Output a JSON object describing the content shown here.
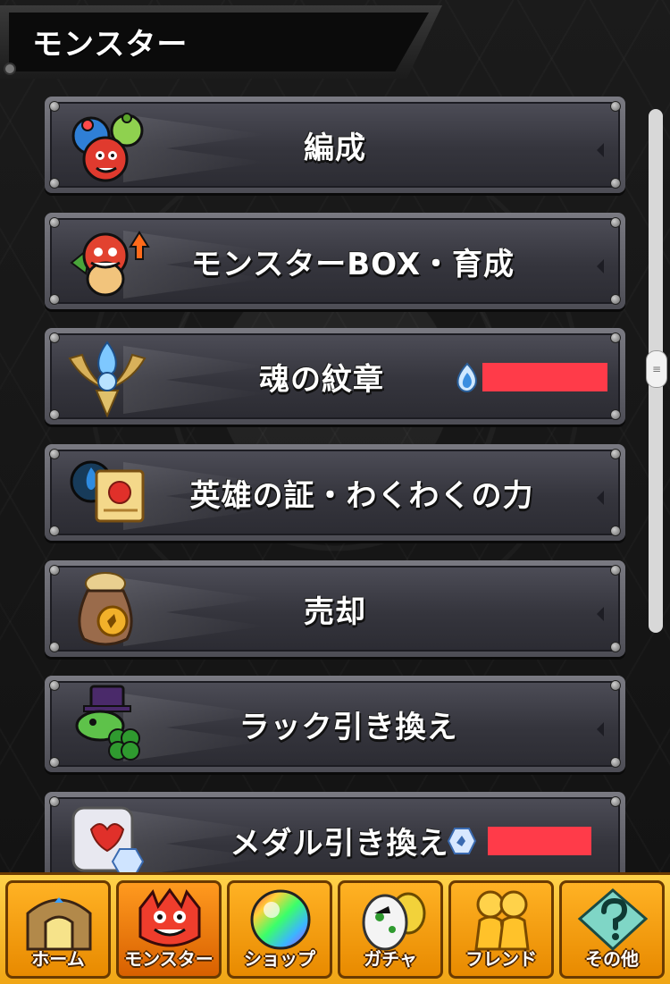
{
  "header": {
    "title": "モンスター"
  },
  "menu": {
    "items": [
      {
        "label": "編成",
        "icon": "monster-group-icon"
      },
      {
        "label": "モンスターBOX・育成",
        "icon": "dragon-powerup-icon"
      },
      {
        "label": "魂の紋章",
        "icon": "winged-soul-emblem-icon",
        "counter_icon": "blue-flame-icon"
      },
      {
        "label": "英雄の証・わくわくの力",
        "icon": "hero-scroll-icon"
      },
      {
        "label": "売却",
        "icon": "coin-sack-icon"
      },
      {
        "label": "ラック引き換え",
        "icon": "clover-frog-icon"
      },
      {
        "label": "メダル引き換え",
        "icon": "medal-card-icon",
        "counter_icon": "medal-icon"
      }
    ]
  },
  "nav": {
    "items": [
      {
        "label": "ホーム",
        "icon": "home-gate-icon"
      },
      {
        "label": "モンスター",
        "icon": "monster-head-icon",
        "active": true
      },
      {
        "label": "ショップ",
        "icon": "rainbow-orb-icon"
      },
      {
        "label": "ガチャ",
        "icon": "gacha-egg-icon"
      },
      {
        "label": "フレンド",
        "icon": "friends-icon"
      },
      {
        "label": "その他",
        "icon": "other-question-icon"
      }
    ]
  },
  "colors": {
    "counter_redacted": "#ff3b49",
    "nav_gold": "#ffb224",
    "panel_dark": "#35353d"
  }
}
